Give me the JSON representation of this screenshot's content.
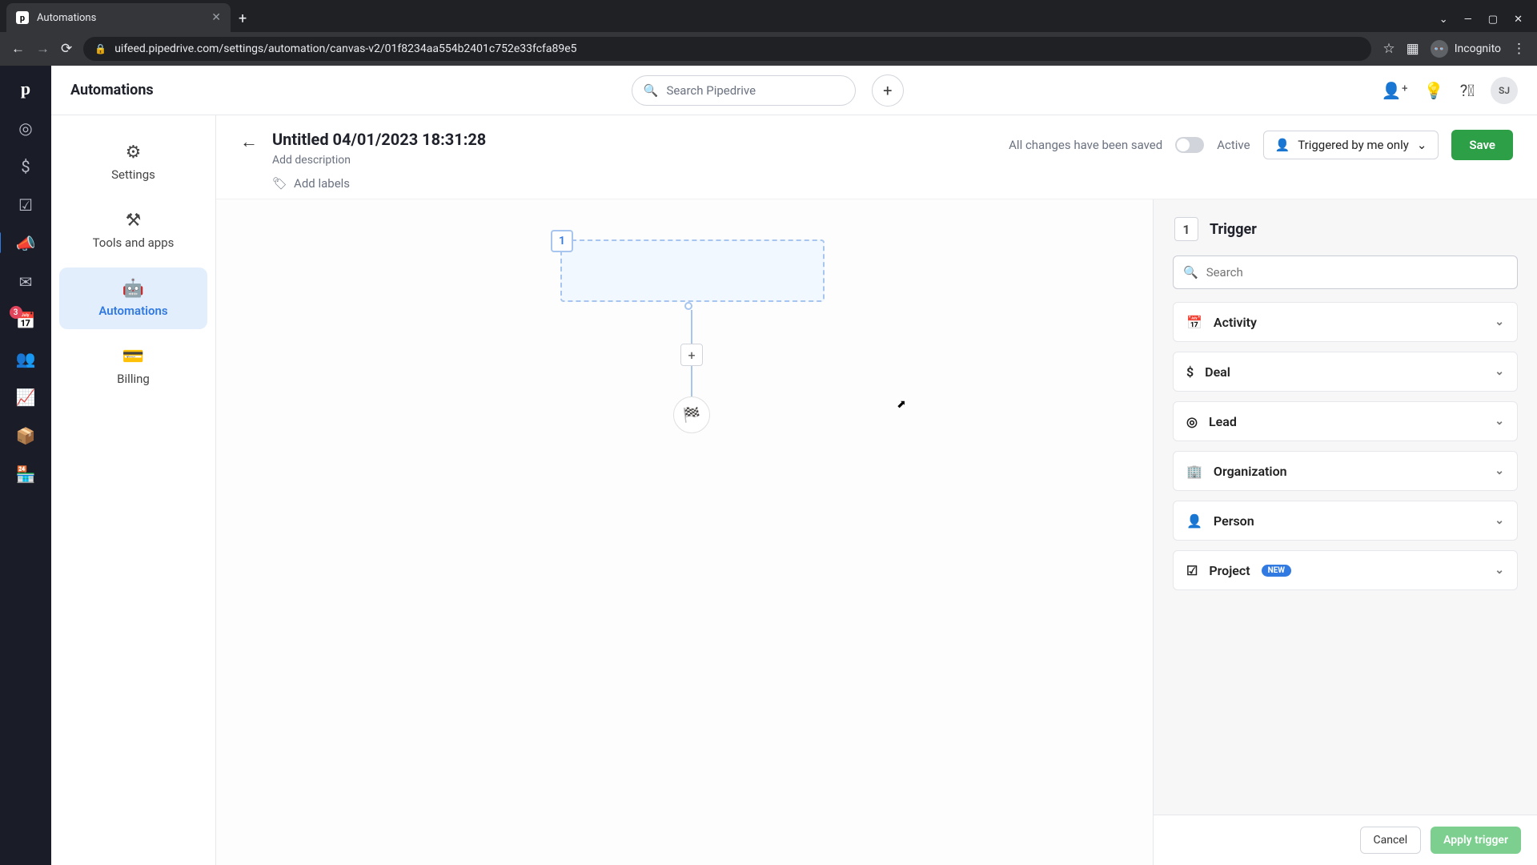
{
  "browser": {
    "tab_title": "Automations",
    "url": "uifeed.pipedrive.com/settings/automation/canvas-v2/01f8234aa554b2401c752e33fcfa89e5",
    "incognito_label": "Incognito"
  },
  "header": {
    "title": "Automations",
    "search_placeholder": "Search Pipedrive",
    "avatar_initials": "SJ"
  },
  "side_menu": {
    "items": [
      {
        "label": "Settings",
        "icon": "gear"
      },
      {
        "label": "Tools and apps",
        "icon": "tools"
      },
      {
        "label": "Automations",
        "icon": "robot"
      },
      {
        "label": "Billing",
        "icon": "card"
      }
    ]
  },
  "left_rail": {
    "badge_count": "3"
  },
  "automation": {
    "title": "Untitled 04/01/2023 18:31:28",
    "add_description": "Add description",
    "add_labels": "Add labels",
    "saved_text": "All changes have been saved",
    "active_label": "Active",
    "triggered_by": "Triggered by me only",
    "save_label": "Save",
    "trigger_step": "1"
  },
  "panel": {
    "step": "1",
    "title": "Trigger",
    "search_placeholder": "Search",
    "categories": [
      {
        "label": "Activity",
        "icon": "calendar"
      },
      {
        "label": "Deal",
        "icon": "dollar"
      },
      {
        "label": "Lead",
        "icon": "target"
      },
      {
        "label": "Organization",
        "icon": "building"
      },
      {
        "label": "Person",
        "icon": "person"
      },
      {
        "label": "Project",
        "icon": "check-square",
        "badge": "NEW"
      }
    ],
    "cancel_label": "Cancel",
    "apply_label": "Apply trigger"
  }
}
